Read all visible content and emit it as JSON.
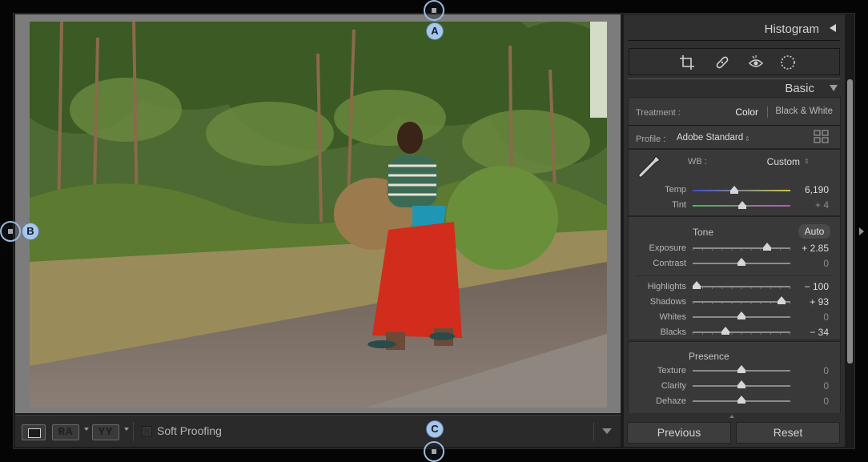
{
  "histogram_header": {
    "title": "Histogram"
  },
  "basic_header": {
    "title": "Basic"
  },
  "tools": [
    "crop-icon",
    "healing-icon",
    "red-eye-icon",
    "masking-icon"
  ],
  "treatment": {
    "label": "Treatment :",
    "color": "Color",
    "bw": "Black & White"
  },
  "profile": {
    "label": "Profile :",
    "value": "Adobe Standard"
  },
  "wb": {
    "label": "WB :",
    "value": "Custom"
  },
  "sliders": {
    "temp": {
      "label": "Temp",
      "value": "6,190",
      "pos": 0.43
    },
    "tint": {
      "label": "Tint",
      "value": "+ 4",
      "pos": 0.51
    },
    "exposure": {
      "label": "Exposure",
      "value": "+ 2.85",
      "pos": 0.76
    },
    "contrast": {
      "label": "Contrast",
      "value": "0",
      "pos": 0.5
    },
    "highlights": {
      "label": "Highlights",
      "value": "− 100",
      "pos": 0.04
    },
    "shadows": {
      "label": "Shadows",
      "value": "+ 93",
      "pos": 0.91
    },
    "whites": {
      "label": "Whites",
      "value": "0",
      "pos": 0.5
    },
    "blacks": {
      "label": "Blacks",
      "value": "− 34",
      "pos": 0.34
    },
    "texture": {
      "label": "Texture",
      "value": "0",
      "pos": 0.5
    },
    "clarity": {
      "label": "Clarity",
      "value": "0",
      "pos": 0.5
    },
    "dehaze": {
      "label": "Dehaze",
      "value": "0",
      "pos": 0.5
    }
  },
  "tone": {
    "title": "Tone",
    "auto": "Auto"
  },
  "presence": {
    "title": "Presence"
  },
  "toolbar": {
    "ra": "RA",
    "yy": "YY",
    "soft_proofing": "Soft Proofing"
  },
  "buttons": {
    "previous": "Previous",
    "reset": "Reset"
  },
  "markers": {
    "a": "A",
    "b": "B",
    "c": "C"
  },
  "colors": {
    "panel_bg": "#2f2f2f",
    "section_bg": "#393939",
    "photo_border": "#7c7c7c",
    "marker_fill": "#a7c6ea"
  }
}
